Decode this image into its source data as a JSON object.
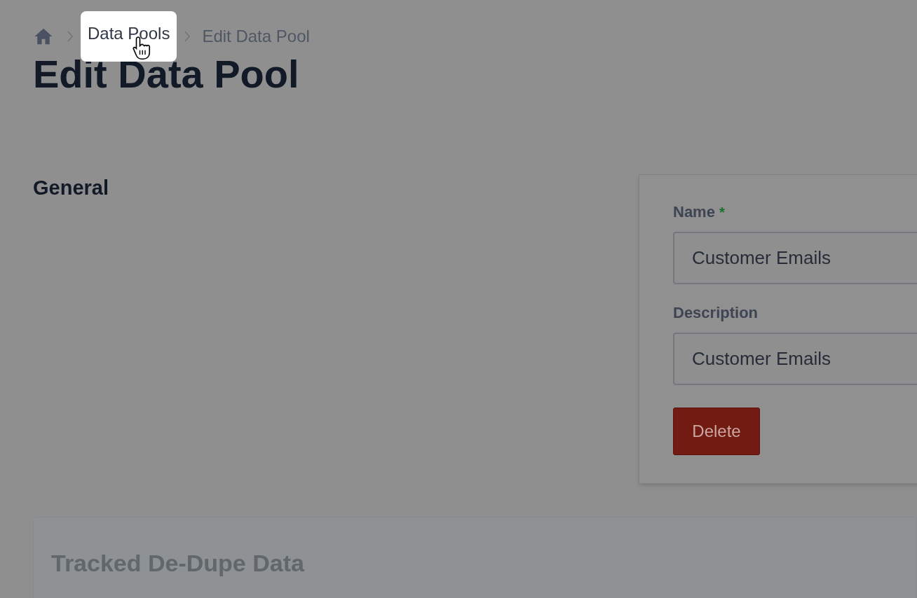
{
  "breadcrumbs": [
    {
      "label": "Data Pools",
      "highlighted": true
    },
    {
      "label": "Edit Data Pool",
      "highlighted": false
    }
  ],
  "page_title": "Edit Data Pool",
  "section": {
    "title": "General"
  },
  "form": {
    "fields": [
      {
        "label": "Name",
        "required_mark": "*",
        "value": "Customer Emails"
      },
      {
        "label": "Description",
        "value": "Customer Emails"
      }
    ],
    "delete_button": "Delete"
  },
  "panel": {
    "title": "Tracked De-Dupe Data"
  }
}
